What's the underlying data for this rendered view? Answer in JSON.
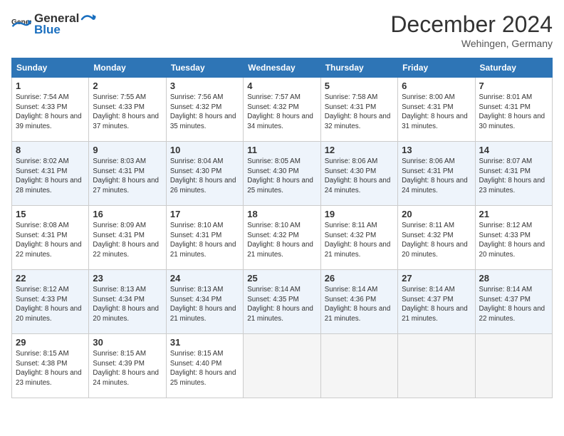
{
  "header": {
    "logo_general": "General",
    "logo_blue": "Blue",
    "month_title": "December 2024",
    "location": "Wehingen, Germany"
  },
  "columns": [
    "Sunday",
    "Monday",
    "Tuesday",
    "Wednesday",
    "Thursday",
    "Friday",
    "Saturday"
  ],
  "weeks": [
    [
      {
        "day": "1",
        "sunrise": "7:54 AM",
        "sunset": "4:33 PM",
        "daylight": "8 hours and 39 minutes."
      },
      {
        "day": "2",
        "sunrise": "7:55 AM",
        "sunset": "4:33 PM",
        "daylight": "8 hours and 37 minutes."
      },
      {
        "day": "3",
        "sunrise": "7:56 AM",
        "sunset": "4:32 PM",
        "daylight": "8 hours and 35 minutes."
      },
      {
        "day": "4",
        "sunrise": "7:57 AM",
        "sunset": "4:32 PM",
        "daylight": "8 hours and 34 minutes."
      },
      {
        "day": "5",
        "sunrise": "7:58 AM",
        "sunset": "4:31 PM",
        "daylight": "8 hours and 32 minutes."
      },
      {
        "day": "6",
        "sunrise": "8:00 AM",
        "sunset": "4:31 PM",
        "daylight": "8 hours and 31 minutes."
      },
      {
        "day": "7",
        "sunrise": "8:01 AM",
        "sunset": "4:31 PM",
        "daylight": "8 hours and 30 minutes."
      }
    ],
    [
      {
        "day": "8",
        "sunrise": "8:02 AM",
        "sunset": "4:31 PM",
        "daylight": "8 hours and 28 minutes."
      },
      {
        "day": "9",
        "sunrise": "8:03 AM",
        "sunset": "4:31 PM",
        "daylight": "8 hours and 27 minutes."
      },
      {
        "day": "10",
        "sunrise": "8:04 AM",
        "sunset": "4:30 PM",
        "daylight": "8 hours and 26 minutes."
      },
      {
        "day": "11",
        "sunrise": "8:05 AM",
        "sunset": "4:30 PM",
        "daylight": "8 hours and 25 minutes."
      },
      {
        "day": "12",
        "sunrise": "8:06 AM",
        "sunset": "4:30 PM",
        "daylight": "8 hours and 24 minutes."
      },
      {
        "day": "13",
        "sunrise": "8:06 AM",
        "sunset": "4:31 PM",
        "daylight": "8 hours and 24 minutes."
      },
      {
        "day": "14",
        "sunrise": "8:07 AM",
        "sunset": "4:31 PM",
        "daylight": "8 hours and 23 minutes."
      }
    ],
    [
      {
        "day": "15",
        "sunrise": "8:08 AM",
        "sunset": "4:31 PM",
        "daylight": "8 hours and 22 minutes."
      },
      {
        "day": "16",
        "sunrise": "8:09 AM",
        "sunset": "4:31 PM",
        "daylight": "8 hours and 22 minutes."
      },
      {
        "day": "17",
        "sunrise": "8:10 AM",
        "sunset": "4:31 PM",
        "daylight": "8 hours and 21 minutes."
      },
      {
        "day": "18",
        "sunrise": "8:10 AM",
        "sunset": "4:32 PM",
        "daylight": "8 hours and 21 minutes."
      },
      {
        "day": "19",
        "sunrise": "8:11 AM",
        "sunset": "4:32 PM",
        "daylight": "8 hours and 21 minutes."
      },
      {
        "day": "20",
        "sunrise": "8:11 AM",
        "sunset": "4:32 PM",
        "daylight": "8 hours and 20 minutes."
      },
      {
        "day": "21",
        "sunrise": "8:12 AM",
        "sunset": "4:33 PM",
        "daylight": "8 hours and 20 minutes."
      }
    ],
    [
      {
        "day": "22",
        "sunrise": "8:12 AM",
        "sunset": "4:33 PM",
        "daylight": "8 hours and 20 minutes."
      },
      {
        "day": "23",
        "sunrise": "8:13 AM",
        "sunset": "4:34 PM",
        "daylight": "8 hours and 20 minutes."
      },
      {
        "day": "24",
        "sunrise": "8:13 AM",
        "sunset": "4:34 PM",
        "daylight": "8 hours and 21 minutes."
      },
      {
        "day": "25",
        "sunrise": "8:14 AM",
        "sunset": "4:35 PM",
        "daylight": "8 hours and 21 minutes."
      },
      {
        "day": "26",
        "sunrise": "8:14 AM",
        "sunset": "4:36 PM",
        "daylight": "8 hours and 21 minutes."
      },
      {
        "day": "27",
        "sunrise": "8:14 AM",
        "sunset": "4:37 PM",
        "daylight": "8 hours and 21 minutes."
      },
      {
        "day": "28",
        "sunrise": "8:14 AM",
        "sunset": "4:37 PM",
        "daylight": "8 hours and 22 minutes."
      }
    ],
    [
      {
        "day": "29",
        "sunrise": "8:15 AM",
        "sunset": "4:38 PM",
        "daylight": "8 hours and 23 minutes."
      },
      {
        "day": "30",
        "sunrise": "8:15 AM",
        "sunset": "4:39 PM",
        "daylight": "8 hours and 24 minutes."
      },
      {
        "day": "31",
        "sunrise": "8:15 AM",
        "sunset": "4:40 PM",
        "daylight": "8 hours and 25 minutes."
      },
      null,
      null,
      null,
      null
    ]
  ],
  "labels": {
    "sunrise": "Sunrise:",
    "sunset": "Sunset:",
    "daylight": "Daylight:"
  }
}
